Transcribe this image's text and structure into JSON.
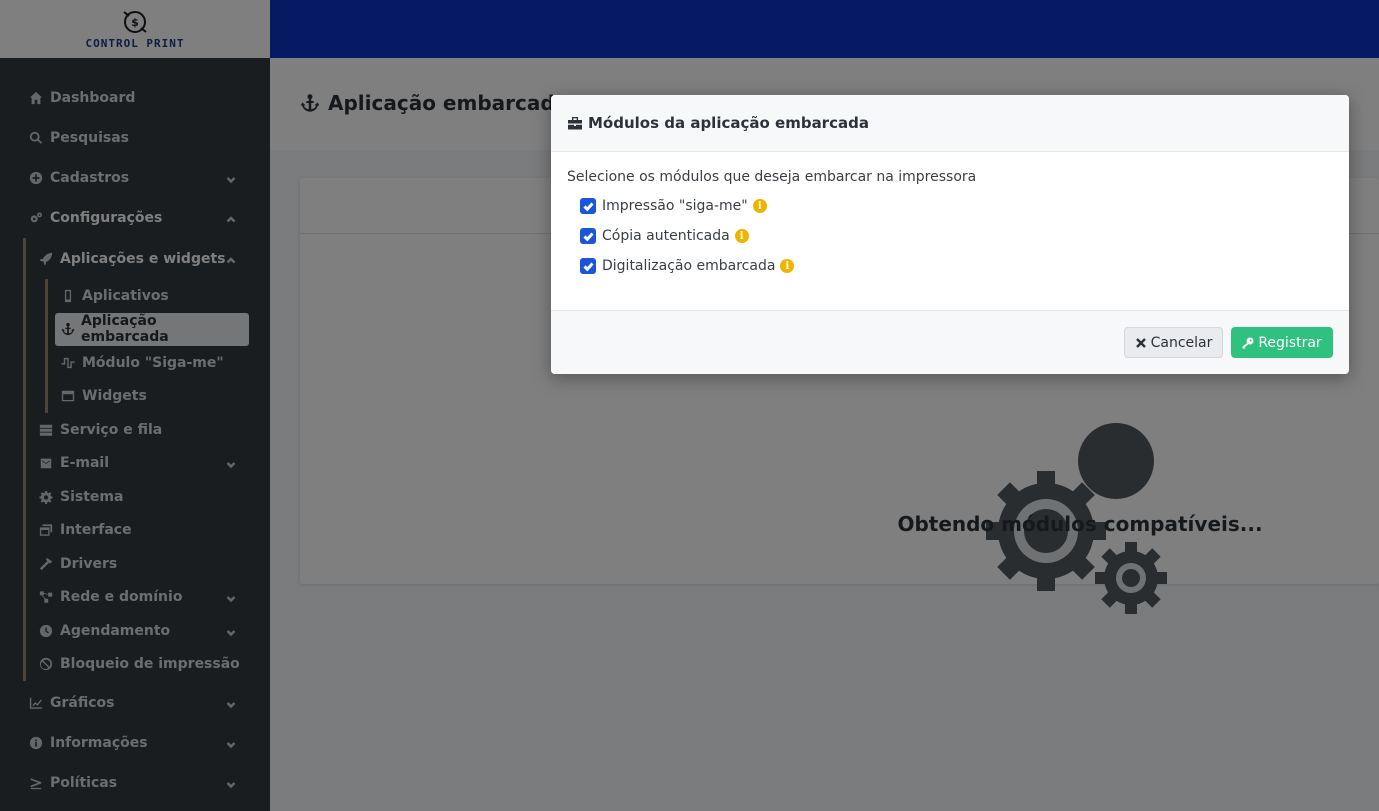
{
  "brand": {
    "name": "CONTROL PRINT"
  },
  "sidebar": {
    "items": [
      {
        "label": "Dashboard",
        "icon": "home-icon"
      },
      {
        "label": "Pesquisas",
        "icon": "search-icon"
      },
      {
        "label": "Cadastros",
        "icon": "plus-circle-icon"
      },
      {
        "label": "Configurações",
        "icon": "cogs-icon"
      }
    ],
    "config_sub": {
      "apps_label": "Aplicações e widgets",
      "apps_items": [
        {
          "label": "Aplicativos",
          "icon": "mobile-icon"
        },
        {
          "label": "Aplicação embarcada",
          "icon": "anchor-icon"
        },
        {
          "label": "Módulo \"Siga-me\"",
          "icon": "wave-icon"
        },
        {
          "label": "Widgets",
          "icon": "window-icon"
        }
      ],
      "other_items": [
        {
          "label": "Serviço e fila",
          "icon": "server-icon"
        },
        {
          "label": "E-mail",
          "icon": "mail-bulk-icon"
        },
        {
          "label": "Sistema",
          "icon": "gear-icon"
        },
        {
          "label": "Interface",
          "icon": "windows-icon"
        },
        {
          "label": "Drivers",
          "icon": "hammer-icon"
        },
        {
          "label": "Rede e domínio",
          "icon": "network-icon"
        },
        {
          "label": "Agendamento",
          "icon": "clock-icon"
        },
        {
          "label": "Bloqueio de impressão",
          "icon": "ban-icon"
        }
      ]
    },
    "bottom_items": [
      {
        "label": "Gráficos",
        "icon": "chart-line-icon"
      },
      {
        "label": "Informações",
        "icon": "info-circle-icon"
      },
      {
        "label": "Políticas",
        "icon": "greater-equal-icon"
      }
    ]
  },
  "page": {
    "title": "Aplicação embarcada",
    "loading_text": "Obtendo módulos compatíveis..."
  },
  "modal": {
    "title": "Módulos da aplicação embarcada",
    "intro": "Selecione os módulos que deseja embarcar na impressora",
    "modules": [
      {
        "label": "Impressão \"siga-me\"",
        "checked": true
      },
      {
        "label": "Cópia autenticada",
        "checked": true
      },
      {
        "label": "Digitalização embarcada",
        "checked": true
      }
    ],
    "cancel_label": "Cancelar",
    "register_label": "Registrar"
  },
  "colors": {
    "topbar": "#0d35c9",
    "sidebar": "#343a40",
    "register": "#2ec27e",
    "checkbox": "#1a56db",
    "info": "#f0b400"
  }
}
